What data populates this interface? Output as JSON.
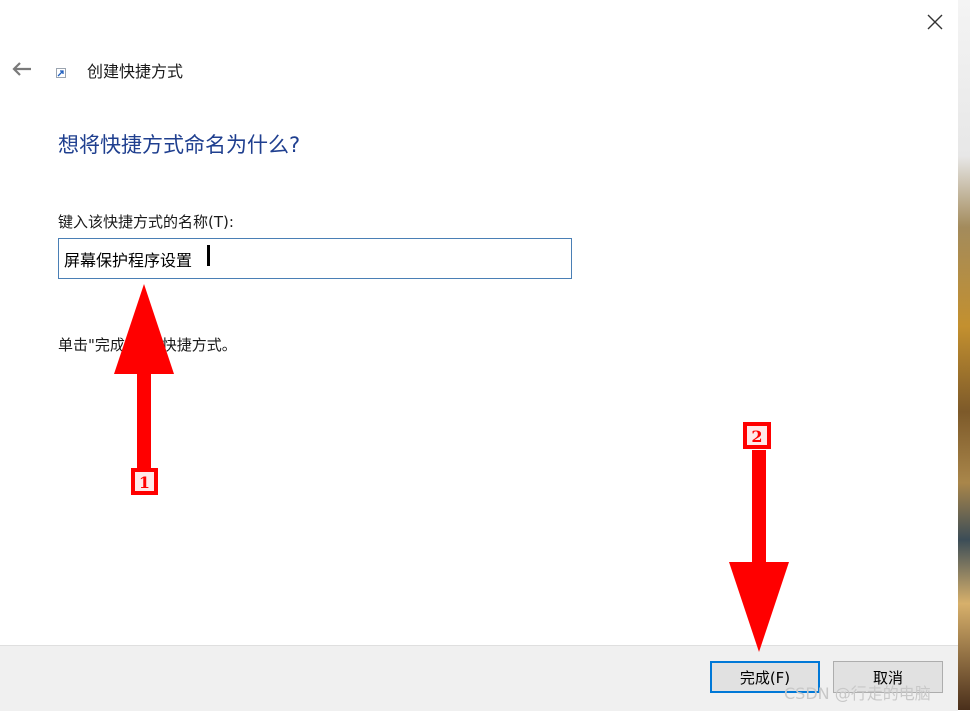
{
  "window": {
    "title": "创建快捷方式",
    "close_glyph": "✕",
    "back_glyph": "←"
  },
  "main": {
    "heading": "想将快捷方式命名为什么?",
    "field_label": "键入该快捷方式的名称(T):",
    "name_value": "屏幕保护程序设置",
    "hint": "单击\"完成\"创建快捷方式。"
  },
  "footer": {
    "finish_label": "完成(F)",
    "cancel_label": "取消"
  },
  "annotations": {
    "markers": [
      "1",
      "2"
    ],
    "color": "#ff0000"
  },
  "watermark": "CSDN @行走的电脑"
}
